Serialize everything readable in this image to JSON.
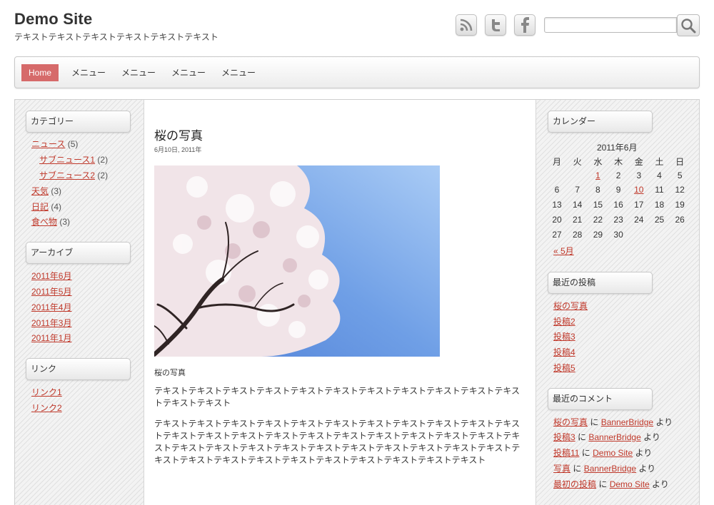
{
  "site": {
    "title": "Demo Site",
    "description": "テキストテキストテキストテキストテキストテキスト"
  },
  "header_icons": [
    "rss-icon",
    "twitter-icon",
    "facebook-icon",
    "search-icon"
  ],
  "search": {
    "value": "",
    "placeholder": ""
  },
  "nav": {
    "items": [
      {
        "label": "Home",
        "active": true
      },
      {
        "label": "メニュー"
      },
      {
        "label": "メニュー"
      },
      {
        "label": "メニュー"
      },
      {
        "label": "メニュー"
      }
    ]
  },
  "sidebar_left": {
    "categories": {
      "title": "カテゴリー",
      "items": [
        {
          "label": "ニュース",
          "count": "(5)"
        },
        {
          "label": "サブニュース1",
          "count": "(2)"
        },
        {
          "label": "サブニュース2",
          "count": "(2)"
        },
        {
          "label": "天気",
          "count": "(3)"
        },
        {
          "label": "日記",
          "count": "(4)"
        },
        {
          "label": "食べ物",
          "count": "(3)"
        }
      ]
    },
    "archives": {
      "title": "アーカイブ",
      "items": [
        "2011年6月",
        "2011年5月",
        "2011年4月",
        "2011年3月",
        "2011年1月"
      ]
    },
    "links": {
      "title": "リンク",
      "items": [
        "リンク1",
        "リンク2"
      ]
    }
  },
  "post": {
    "title": "桜の写真",
    "date": "6月10日, 2011年",
    "caption": "桜の写真",
    "paragraphs": [
      "テキストテキストテキストテキストテキストテキストテキストテキストテキストテキストテキストテキストテキスト",
      "テキストテキストテキストテキストテキストテキストテキストテキストテキストテキストテキストテキストテキストテキストテキストテキストテキストテキストテキストテキストテキストテキストテキストテキストテキストテキストテキストテキストテキストテキストテキストテキストテキストテキストテキストテキストテキストテキストテキストテキストテキストテキスト"
    ]
  },
  "sidebar_right": {
    "calendar": {
      "title": "カレンダー",
      "caption": "2011年6月",
      "weekdays": [
        "月",
        "火",
        "水",
        "木",
        "金",
        "土",
        "日"
      ],
      "rows": [
        [
          "",
          "",
          "1",
          "2",
          "3",
          "4",
          "5"
        ],
        [
          "6",
          "7",
          "8",
          "9",
          "10",
          "11",
          "12"
        ],
        [
          "13",
          "14",
          "15",
          "16",
          "17",
          "18",
          "19"
        ],
        [
          "20",
          "21",
          "22",
          "23",
          "24",
          "25",
          "26"
        ],
        [
          "27",
          "28",
          "29",
          "30",
          "",
          "",
          ""
        ]
      ],
      "linked_days": [
        "1",
        "10"
      ],
      "prev_label": "« 5月"
    },
    "recent_posts": {
      "title": "最近の投稿",
      "items": [
        "桜の写真",
        "投稿2",
        "投稿3",
        "投稿4",
        "投稿5"
      ]
    },
    "recent_comments": {
      "title": "最近のコメント",
      "items": [
        {
          "post": "桜の写真",
          "sep": " に ",
          "author": "BannerBridge",
          "suffix": " より"
        },
        {
          "post": "投稿3",
          "sep": " に ",
          "author": "BannerBridge",
          "suffix": " より"
        },
        {
          "post": "投稿11",
          "sep": " に ",
          "author": "Demo Site",
          "suffix": " より"
        },
        {
          "post": "写真",
          "sep": " に ",
          "author": "BannerBridge",
          "suffix": " より"
        },
        {
          "post": "最初の投稿",
          "sep": " に ",
          "author": "Demo Site",
          "suffix": " より"
        }
      ]
    }
  },
  "colors": {
    "accent": "#d66a6a",
    "link": "#c0392b",
    "text": "#333333",
    "sky": "#8ab4f0"
  }
}
